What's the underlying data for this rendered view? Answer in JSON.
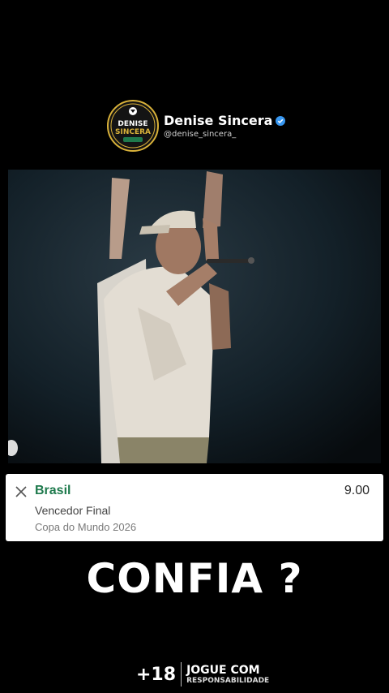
{
  "profile": {
    "name": "Denise Sincera",
    "handle": "@denise_sincera_",
    "logo_line1": "DENISE",
    "logo_line2": "SINCERA",
    "verified_icon": "verified-badge-icon",
    "verified_color": "#3897f0",
    "logo_ring_color": "#d9b23a"
  },
  "bet": {
    "team": "Brasil",
    "odds": "9.00",
    "market": "Vencedor Final",
    "event": "Copa do Mundo 2026",
    "team_color": "#1f7a4d",
    "close_icon": "close-icon"
  },
  "caption": "CONFIA ?",
  "footer": {
    "age": "+18",
    "line1": "JOGUE COM",
    "line2": "RESPONSABILIDADE"
  }
}
